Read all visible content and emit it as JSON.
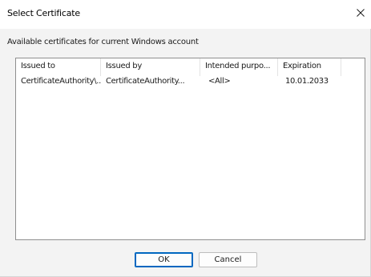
{
  "window": {
    "title": "Select Certificate"
  },
  "subtitle": "Available certificates for current Windows account",
  "table": {
    "columns": [
      "Issued to",
      "Issued by",
      "Intended purpo...",
      "Expiration"
    ],
    "rows": [
      [
        "CertificateAuthority\\...",
        "CertificateAuthority...",
        "<All>",
        "10.01.2033"
      ]
    ]
  },
  "buttons": {
    "ok": "OK",
    "cancel": "Cancel"
  },
  "icons": {
    "close": "close-icon"
  }
}
